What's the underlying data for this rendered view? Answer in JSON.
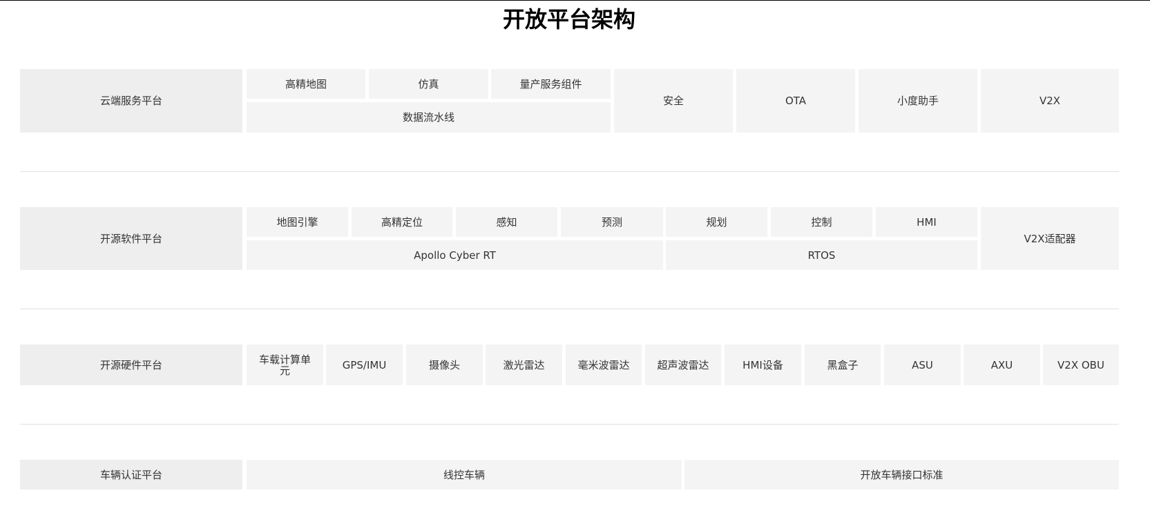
{
  "title": "开放平台架构",
  "cloud": {
    "label": "云端服务平台",
    "hd_map": "高精地图",
    "simulation": "仿真",
    "mass_production": "量产服务组件",
    "data_pipeline": "数据流水线",
    "security": "安全",
    "ota": "OTA",
    "xiaodu": "小度助手",
    "v2x": "V2X"
  },
  "software": {
    "label": "开源软件平台",
    "map_engine": "地图引擎",
    "localization": "高精定位",
    "perception": "感知",
    "prediction": "预测",
    "planning": "规划",
    "control": "控制",
    "hmi": "HMI",
    "cyber_rt": "Apollo Cyber RT",
    "rtos": "RTOS",
    "v2x_adapter": "V2X适配器"
  },
  "hardware": {
    "label": "开源硬件平台",
    "items": [
      "车载计算单元",
      "GPS/IMU",
      "摄像头",
      "激光雷达",
      "毫米波雷达",
      "超声波雷达",
      "HMI设备",
      "黑盒子",
      "ASU",
      "AXU",
      "V2X OBU"
    ]
  },
  "vehicle": {
    "label": "车辆认证平台",
    "drive_by_wire": "线控车辆",
    "open_interface": "开放车辆接口标准"
  }
}
